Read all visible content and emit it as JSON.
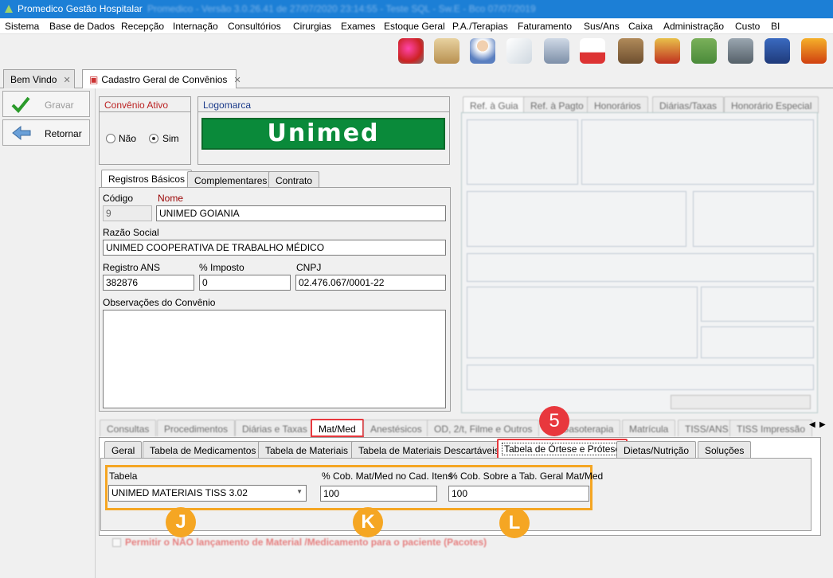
{
  "window": {
    "title": "Promedico Gestão Hospitalar",
    "title_blurred": "Promedico - Versão 3.0.26.41 de 27/07/2020 23:14:55 - Teste SQL - Sw.E - Bco 07/07/2019"
  },
  "menu": [
    "Sistema",
    "Base de Dados",
    "Recepção",
    "Internação",
    "Consultórios",
    "Cirurgias",
    "Exames",
    "Estoque Geral",
    "P.A./Terapias",
    "Faturamento",
    "Sus/Ans",
    "Caixa",
    "Administração",
    "Custo",
    "BI"
  ],
  "toolbar_icons": [
    "refresh-users-icon",
    "reception-icon",
    "doctor-icon",
    "document-icon",
    "bed-icon",
    "ambulance-icon",
    "box-icon",
    "money-up-icon",
    "money-down-icon",
    "safe-icon",
    "calculator-icon",
    "phone-book-icon"
  ],
  "doc_tabs": [
    {
      "label": "Bem Vindo"
    },
    {
      "label": "Cadastro Geral de Convênios"
    }
  ],
  "sidebar": {
    "save_label": "Gravar",
    "back_label": "Retornar"
  },
  "convenio_ativo": {
    "title": "Convênio Ativo",
    "no": "Não",
    "yes": "Sim"
  },
  "logomarca": {
    "title": "Logomarca",
    "logo_text": "Unimed"
  },
  "record_tabs": [
    "Registros Básicos",
    "Complementares",
    "Contrato"
  ],
  "form": {
    "codigo_label": "Código",
    "codigo": "9",
    "nome_label": "Nome",
    "nome": "UNIMED GOIANIA",
    "razao_label": "Razão Social",
    "razao": "UNIMED COOPERATIVA DE TRABALHO MÉDICO",
    "ans_label": "Registro ANS",
    "ans": "382876",
    "imposto_label": "% Imposto",
    "imposto": "0",
    "cnpj_label": "CNPJ",
    "cnpj": "02.476.067/0001-22",
    "obs_label": "Observações do Convênio"
  },
  "right_panel_tabs": [
    "Ref. à Guia",
    "Ref. à Pagto",
    "Honorários",
    "Diárias/Taxas",
    "Honorário Especial"
  ],
  "bottom_tabs": [
    "Consultas",
    "Procedimentos",
    "Diárias e Taxas",
    "Mat/Med",
    "Anestésicos",
    "OD, 2/t, Filme e Outros",
    "Gasoterapia",
    "Matrícula",
    "TISS/ANS",
    "TISS Impressão"
  ],
  "matmed_tabs": [
    "Geral",
    "Tabela de Medicamentos",
    "Tabela de Materiais",
    "Tabela de Materiais Descartáveis",
    "Tabela de Órtese e Prótese",
    "Dietas/Nutrição",
    "Soluções"
  ],
  "orteses": {
    "tabela_label": "Tabela",
    "tabela_value": "UNIMED MATERIAIS TISS 3.02",
    "cob_label": "% Cob. Mat/Med no Cad. Itens",
    "cob_value": "100",
    "cob_sobre_label": "% Cob. Sobre a Tab. Geral Mat/Med",
    "cob_sobre_value": "100"
  },
  "footer_text": "Permitir o NÃO lançamento de Material /Medicamento para o paciente (Pacotes)",
  "badges": {
    "step": "5",
    "j": "J",
    "k": "K",
    "l": "L"
  },
  "colors": {
    "title_bar": "#1c7fd6",
    "highlight_red": "#e8383d",
    "highlight_orange": "#f5a623",
    "logo_green": "#0a8a3a"
  }
}
